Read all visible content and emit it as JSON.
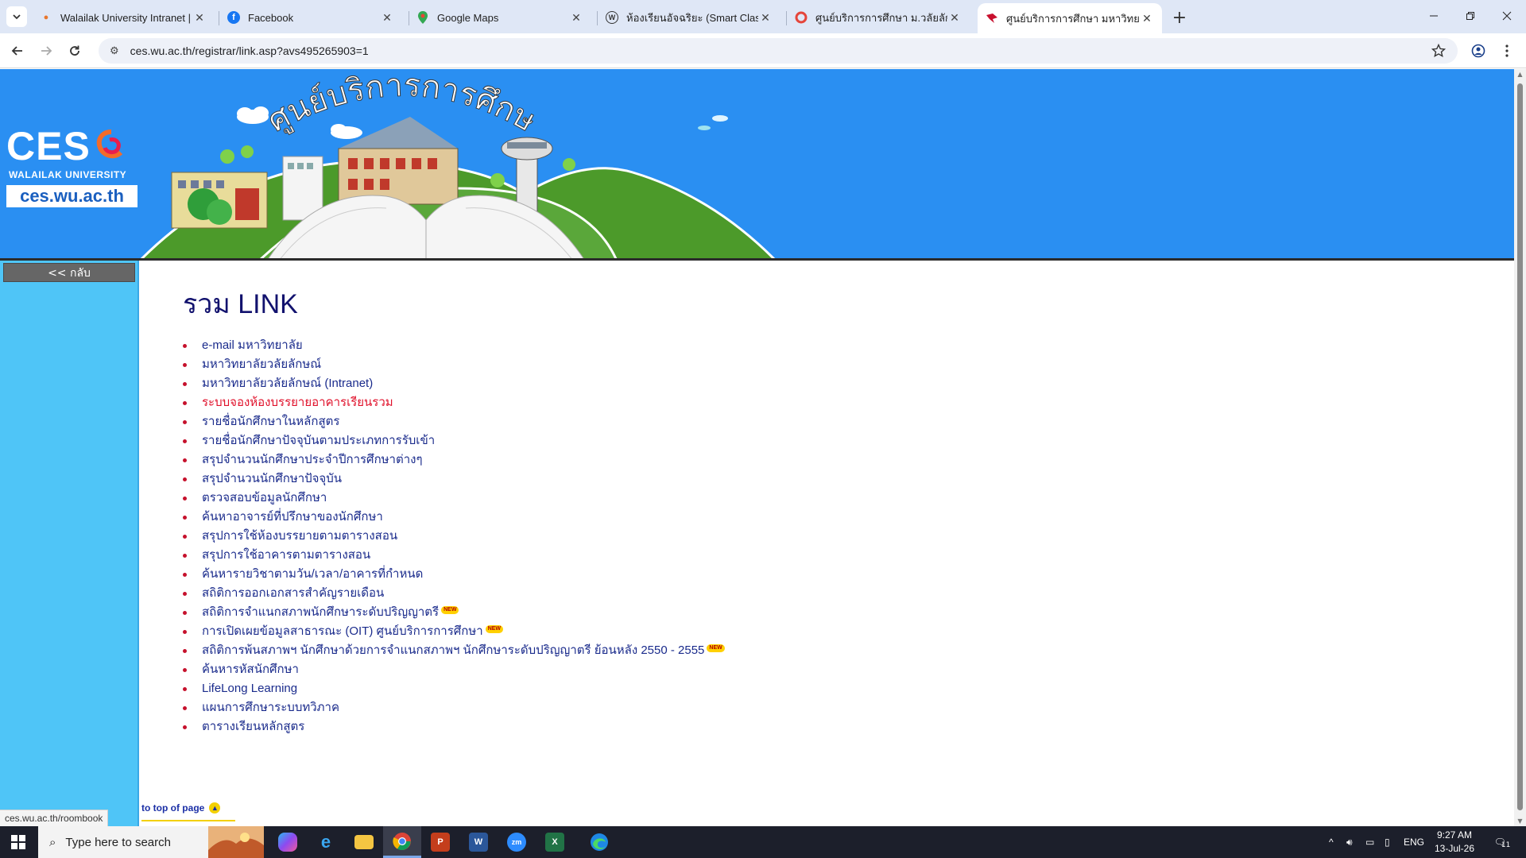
{
  "browser": {
    "tabs": [
      {
        "title": "Walailak University Intranet | ลืม",
        "favicon": "flame-icon",
        "active": false
      },
      {
        "title": "Facebook",
        "favicon": "facebook-icon",
        "active": false
      },
      {
        "title": "Google Maps",
        "favicon": "maps-pin-icon",
        "active": false
      },
      {
        "title": "ห้องเรียนอัจฉริยะ (Smart Classroom",
        "favicon": "wordpress-icon",
        "active": false
      },
      {
        "title": "ศูนย์บริการการศึกษา ม.วลัยลักษณ์",
        "favicon": "red-circle-icon",
        "active": false
      },
      {
        "title": "ศูนย์บริการการศึกษา มหาวิทยาลัยวลั",
        "favicon": "red-wing-icon",
        "active": true
      }
    ],
    "url": "ces.wu.ac.th/registrar/link.asp?avs495265903=1",
    "status_url": "ces.wu.ac.th/roombook",
    "accent_color": "#dfe7f6"
  },
  "site": {
    "logo_text": "CES",
    "logo_sub": "WALAILAK UNIVERSITY",
    "logo_url": "ces.wu.ac.th",
    "banner_text": "ศูนย์บริการการศึกษา",
    "header_color": "#2a8ff2",
    "sidebar_color": "#4fc5f7",
    "back_label": "<< กลับ",
    "page_title": "รวม LINK",
    "links": [
      {
        "label": "e-mail มหาวิทยาลัย",
        "new": false,
        "hot": false
      },
      {
        "label": "มหาวิทยาลัยวลัยลักษณ์",
        "new": false,
        "hot": false
      },
      {
        "label": "มหาวิทยาลัยวลัยลักษณ์ (Intranet)",
        "new": false,
        "hot": false
      },
      {
        "label": "ระบบจองห้องบรรยายอาคารเรียนรวม",
        "new": false,
        "hot": true
      },
      {
        "label": "รายชื่อนักศึกษาในหลักสูตร",
        "new": false,
        "hot": false
      },
      {
        "label": "รายชื่อนักศึกษาปัจจุบันตามประเภทการรับเข้า",
        "new": false,
        "hot": false
      },
      {
        "label": "สรุปจำนวนนักศึกษาประจำปีการศึกษาต่างๆ",
        "new": false,
        "hot": false
      },
      {
        "label": "สรุปจำนวนนักศึกษาปัจจุบัน",
        "new": false,
        "hot": false
      },
      {
        "label": "ตรวจสอบข้อมูลนักศึกษา",
        "new": false,
        "hot": false
      },
      {
        "label": "ค้นหาอาจารย์ที่ปรึกษาของนักศึกษา",
        "new": false,
        "hot": false
      },
      {
        "label": "สรุปการใช้ห้องบรรยายตามตารางสอน",
        "new": false,
        "hot": false
      },
      {
        "label": "สรุปการใช้อาคารตามตารางสอน",
        "new": false,
        "hot": false
      },
      {
        "label": "ค้นหารายวิชาตามวัน/เวลา/อาคารที่กำหนด",
        "new": false,
        "hot": false
      },
      {
        "label": "สถิติการออกเอกสารสำคัญรายเดือน",
        "new": false,
        "hot": false
      },
      {
        "label": "สถิติการจำแนกสภาพนักศึกษาระดับปริญญาตรี",
        "new": true,
        "hot": false
      },
      {
        "label": "การเปิดเผยข้อมูลสาธารณะ (OIT) ศูนย์บริการการศึกษา",
        "new": true,
        "hot": false
      },
      {
        "label": "สถิติการพ้นสภาพฯ นักศึกษาด้วยการจำแนกสภาพฯ นักศึกษาระดับปริญญาตรี ย้อนหลัง 2550 - 2555",
        "new": true,
        "hot": false
      },
      {
        "label": "ค้นหารหัสนักศึกษา",
        "new": false,
        "hot": false
      },
      {
        "label": "LifeLong Learning",
        "new": false,
        "hot": false
      },
      {
        "label": "แผนการศึกษาระบบทวิภาค",
        "new": false,
        "hot": false
      },
      {
        "label": "ตารางเรียนหลักสูตร",
        "new": false,
        "hot": false
      }
    ],
    "new_badge": "NEW",
    "top_of_page": "to top of page"
  },
  "taskbar": {
    "search_placeholder": "Type here to search",
    "apps": [
      "copilot-icon",
      "internet-explorer-icon",
      "file-explorer-icon",
      "chrome-icon",
      "powerpoint-icon",
      "word-icon",
      "zoom-icon",
      "excel-icon",
      "edge-icon"
    ],
    "language": "ENG",
    "time": "9:27 AM",
    "date": "13-Jul-26",
    "notification_count": "11"
  }
}
